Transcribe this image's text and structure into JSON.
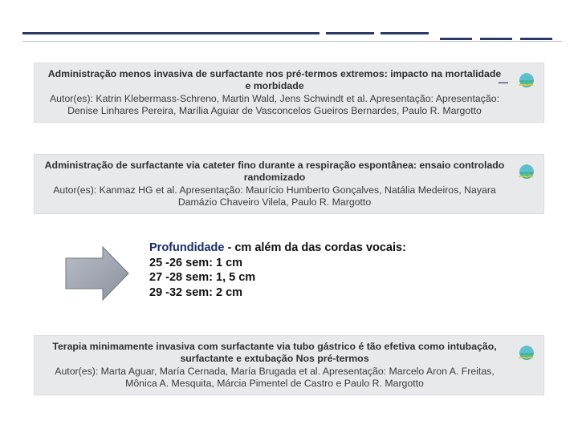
{
  "card1": {
    "title": "Administração menos invasiva de surfactante nos pré-termos extremos: impacto na mortalidade e morbidade",
    "authors": "Autor(es): Katrin Klebermass-Schreno, Martin Wald, Jens Schwindt et al. Apresentação: Apresentação: Denise Linhares Pereira, Marília Aguiar de Vasconcelos Gueiros Bernardes, Paulo R. Margotto"
  },
  "card2": {
    "title": "Administração de surfactante via cateter fino durante a respiração espontânea: ensaio controlado randomizado",
    "authors": "Autor(es): Kanmaz HG et al. Apresentação: Maurício Humberto Gonçalves, Natália Medeiros, Nayara Damázio Chaveiro Vilela, Paulo R. Margotto"
  },
  "mid": {
    "heading": "Profundidade - cm além da das cordas vocais:",
    "l1": "25 -26 sem: 1 cm",
    "l2": "27 -28 sem: 1, 5 cm",
    "l3": "29 -32 sem: 2 cm"
  },
  "card3": {
    "title": "Terapia minimamente invasiva com surfactante via tubo gástrico é tão efetiva como intubação, surfactante e extubação Nos pré-termos",
    "authors": "Autor(es): Marta Aguar, María Cernada, María Brugada et al. Apresentação: Marcelo Aron A. Freitas, Mônica A. Mesquita, Márcia Pimentel de Castro e Paulo R. Margotto"
  },
  "glyphs": {
    "minus": "–"
  }
}
